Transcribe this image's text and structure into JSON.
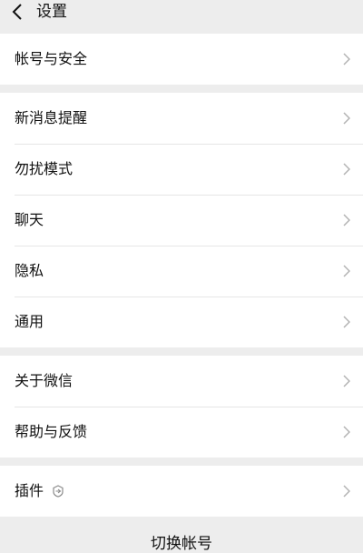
{
  "header": {
    "title": "设置"
  },
  "groups": [
    {
      "items": [
        {
          "label": "帐号与安全"
        }
      ]
    },
    {
      "items": [
        {
          "label": "新消息提醒"
        },
        {
          "label": "勿扰模式"
        },
        {
          "label": "聊天"
        },
        {
          "label": "隐私"
        },
        {
          "label": "通用"
        }
      ]
    },
    {
      "items": [
        {
          "label": "关于微信"
        },
        {
          "label": "帮助与反馈"
        }
      ]
    },
    {
      "items": [
        {
          "label": "插件",
          "icon": "plugin-badge-icon"
        }
      ]
    }
  ],
  "bottom": {
    "label": "切换帐号"
  },
  "colors": {
    "background": "#ededed",
    "card": "#ffffff",
    "text": "#111111",
    "chevron": "#b2b2b2"
  }
}
